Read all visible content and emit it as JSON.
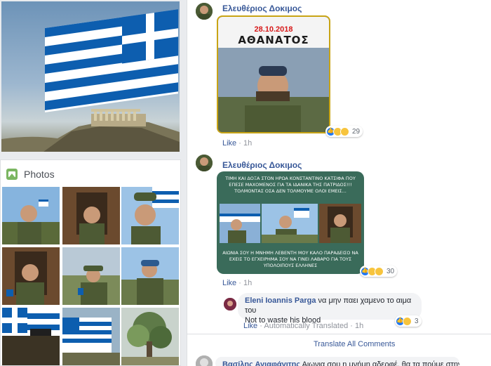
{
  "photos": {
    "title": "Photos",
    "icon": "photos-icon"
  },
  "post1": {
    "author": "Ελευθέριος Δοκιμος",
    "gif_date": "28.10.2018",
    "gif_title": "ΑΘΑΝΑΤΟΣ",
    "reaction_count": "29",
    "like_label": "Like",
    "time": "1h"
  },
  "post2": {
    "author": "Ελευθέριος Δοκιμος",
    "card_text_top": "ΤΙΜΗ ΚΑΙ ΔΟΞΑ ΣΤΟΝ ΗΡΩΑ ΚΟΝΣΤΑΝΤΙΝΟ ΚΑΤΣΙΦΑ ΠΟΥ ΕΠΕΣΕ ΜΑΧΟΜΕΝΟΣ ΓΙΑ ΤΑ ΙΔΑΝΙΚΑ ΤΗΣ ΠΑΤΡΙΔΟΣ!!! ΤΟΛΜΟΝΤΑΣ ΟΣΑ ΔΕΝ ΤΟΛΜΟΥΜΕ ΟΛΟΙ ΕΜΕΙΣ...",
    "card_text_bottom": "ΑΙΩΝΙΑ ΣΟΥ Η ΜΝΗΜΗ ΛΕΒΕΝΤΗ ΜΟΥ ΚΑΛΟ ΠΑΡΑΔΕΙΣΟ ΝΑ ΕΧΕΙΣ ΤΟ ΕΓΧΕΙΡΗΜΑ ΣΟΥ ΝΑ ΓΙΝΕΙ ΛΑΒΑΡΟ ΓΙΑ ΤΟΥΣ ΥΠΟΛΟΙΠΟΥΣ ΕΛΛΗΝΕΣ",
    "reaction_count": "30",
    "like_label": "Like",
    "time": "1h"
  },
  "reply": {
    "author": "Eleni Ioannis Parga",
    "text": "να μην παει χαμενο το αιμα του",
    "translation": "Not to waste his blood",
    "like_label": "Like",
    "translated_label": "Automatically Translated",
    "time": "1h",
    "reaction_count": "3"
  },
  "translate_all": "Translate All Comments",
  "bottom_comment": {
    "author": "Βασίλης Αγιαφάγιτης",
    "text": "Αιωνια σου η μνήμη αδερφέ, θα τα πούμε στην"
  },
  "colors": {
    "link": "#385898",
    "flag_blue": "#0d5eaf",
    "card_green": "#3a6b5a",
    "gif_border": "#c8a415"
  }
}
